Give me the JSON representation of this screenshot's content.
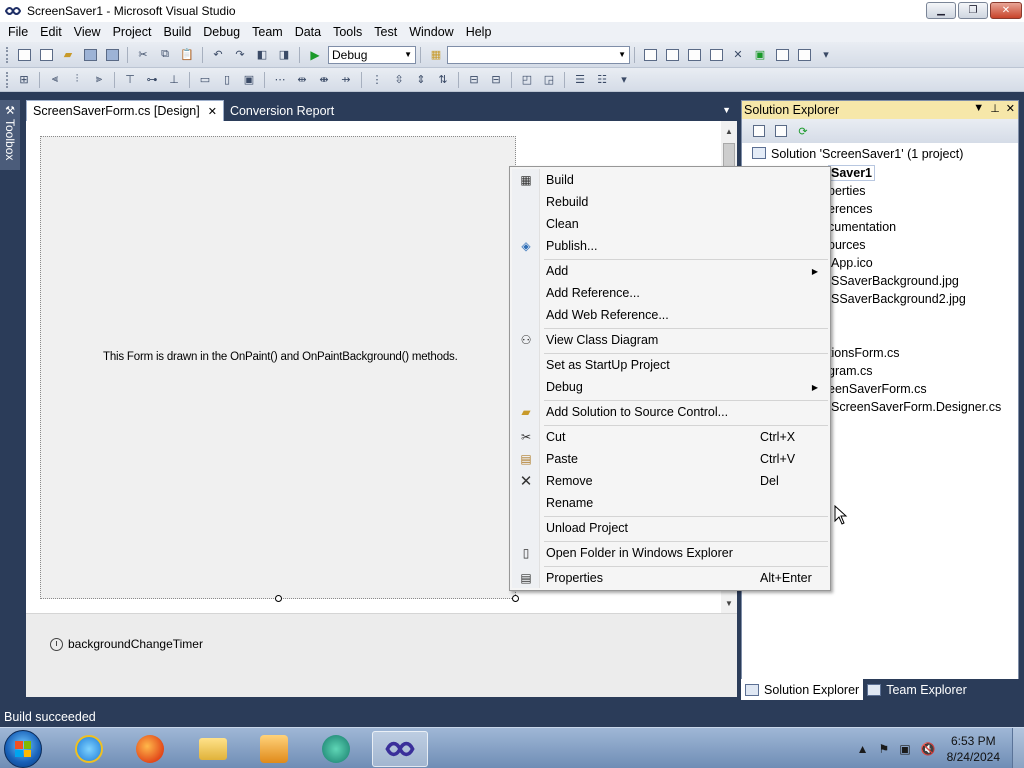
{
  "window": {
    "title": "ScreenSaver1 - Microsoft Visual Studio",
    "buttons": {
      "minimize": "▁",
      "maximize": "❐",
      "close": "✕"
    }
  },
  "menu": [
    "File",
    "Edit",
    "View",
    "Project",
    "Build",
    "Debug",
    "Team",
    "Data",
    "Tools",
    "Test",
    "Window",
    "Help"
  ],
  "toolbar": {
    "config_value": "Debug",
    "platform_value": ""
  },
  "toolbox_label": "Toolbox",
  "tabs": [
    {
      "label": "ScreenSaverForm.cs [Design]",
      "close": "✕"
    },
    {
      "label": "Conversion Report"
    }
  ],
  "designer": {
    "form_text": "This Form is drawn in the OnPaint() and OnPaintBackground() methods.",
    "tray_component": "backgroundChangeTimer"
  },
  "solution_explorer": {
    "title": "Solution Explorer",
    "nodes": [
      "Solution 'ScreenSaver1' (1 project)",
      "Saver1",
      "perties",
      "erences",
      "cumentation",
      "ources",
      "App.ico",
      "SSaverBackground.jpg",
      "SSaverBackground2.jpg",
      "tionsForm.cs",
      "gram.cs",
      "eenSaverForm.cs",
      "ScreenSaverForm.Designer.cs"
    ],
    "bottom_tabs": [
      "Solution Explorer",
      "Team Explorer"
    ]
  },
  "context_menu": {
    "items": [
      {
        "label": "Build",
        "icon": "build-icon",
        "shortcut": ""
      },
      {
        "label": "Rebuild",
        "icon": "",
        "shortcut": ""
      },
      {
        "label": "Clean",
        "icon": "",
        "shortcut": ""
      },
      {
        "label": "Publish...",
        "icon": "publish-icon",
        "shortcut": ""
      },
      {
        "label": "Add",
        "icon": "",
        "shortcut": "",
        "submenu": true
      },
      {
        "label": "Add Reference...",
        "icon": "",
        "shortcut": ""
      },
      {
        "label": "Add Web Reference...",
        "icon": "",
        "shortcut": ""
      },
      {
        "label": "View Class Diagram",
        "icon": "class-diagram-icon",
        "shortcut": ""
      },
      {
        "label": "Set as StartUp Project",
        "icon": "",
        "shortcut": ""
      },
      {
        "label": "Debug",
        "icon": "",
        "shortcut": "",
        "submenu": true
      },
      {
        "label": "Add Solution to Source Control...",
        "icon": "source-control-icon",
        "shortcut": ""
      },
      {
        "label": "Cut",
        "icon": "cut-icon",
        "shortcut": "Ctrl+X"
      },
      {
        "label": "Paste",
        "icon": "paste-icon",
        "shortcut": "Ctrl+V"
      },
      {
        "label": "Remove",
        "icon": "remove-icon",
        "shortcut": "Del"
      },
      {
        "label": "Rename",
        "icon": "",
        "shortcut": ""
      },
      {
        "label": "Unload Project",
        "icon": "",
        "shortcut": ""
      },
      {
        "label": "Open Folder in Windows Explorer",
        "icon": "folder-icon",
        "shortcut": ""
      },
      {
        "label": "Properties",
        "icon": "properties-icon",
        "shortcut": "Alt+Enter"
      }
    ]
  },
  "status": "Build succeeded",
  "taskbar": {
    "time": "6:53 PM",
    "date": "8/24/2024"
  },
  "colors": {
    "ide_frame": "#2b3c59",
    "se_header": "#f6e7a9",
    "build_green": "#1a9a2a"
  }
}
